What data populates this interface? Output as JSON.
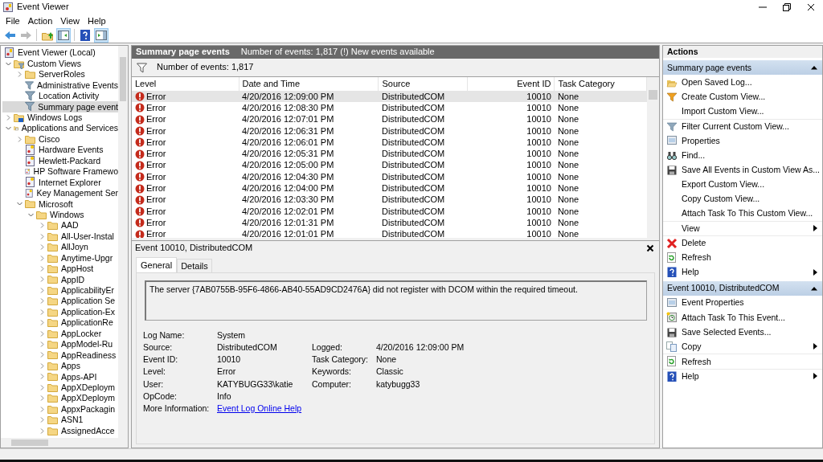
{
  "window": {
    "title": "Event Viewer"
  },
  "menu": [
    "File",
    "Action",
    "View",
    "Help"
  ],
  "toolbar": [
    {
      "kind": "back",
      "disabled": false,
      "pressed": false
    },
    {
      "kind": "forward",
      "disabled": true,
      "pressed": false
    },
    {
      "kind": "separator"
    },
    {
      "kind": "up",
      "disabled": false,
      "pressed": false
    },
    {
      "kind": "console-tree",
      "disabled": false,
      "pressed": true
    },
    {
      "kind": "separator"
    },
    {
      "kind": "help",
      "disabled": false,
      "pressed": false
    },
    {
      "kind": "action-pane",
      "disabled": false,
      "pressed": true
    }
  ],
  "tree": {
    "root": {
      "label": "Event Viewer (Local)",
      "selected": false
    },
    "children": [
      {
        "label": "Custom Views",
        "kind": "custom-views",
        "expanded": true,
        "selected": false,
        "children": [
          {
            "label": "ServerRoles",
            "kind": "folder",
            "expanded": false,
            "selected": false
          },
          {
            "label": "Administrative Events",
            "kind": "filter",
            "selected": false
          },
          {
            "label": "Location Activity",
            "kind": "filter",
            "selected": false
          },
          {
            "label": "Summary page event",
            "kind": "filter",
            "selected": true
          }
        ]
      },
      {
        "label": "Windows Logs",
        "kind": "windows-logs",
        "expanded": false,
        "selected": false
      },
      {
        "label": "Applications and Services",
        "kind": "apps",
        "expanded": true,
        "selected": false,
        "children": [
          {
            "label": "Cisco",
            "kind": "folder",
            "expanded": false,
            "selected": false
          },
          {
            "label": "Hardware Events",
            "kind": "log",
            "selected": false
          },
          {
            "label": "Hewlett-Packard",
            "kind": "log",
            "selected": false
          },
          {
            "label": "HP Software Framewo",
            "kind": "log",
            "selected": false
          },
          {
            "label": "Internet Explorer",
            "kind": "log",
            "selected": false
          },
          {
            "label": "Key Management Ser",
            "kind": "log",
            "selected": false
          },
          {
            "label": "Microsoft",
            "kind": "folder",
            "expanded": true,
            "selected": false,
            "children": [
              {
                "label": "Windows",
                "kind": "folder",
                "expanded": true,
                "selected": false,
                "children": [
                  {
                    "label": "AAD",
                    "kind": "folder",
                    "expanded": false,
                    "selected": false
                  },
                  {
                    "label": "All-User-Instal",
                    "kind": "folder",
                    "expanded": false,
                    "selected": false
                  },
                  {
                    "label": "AllJoyn",
                    "kind": "folder",
                    "expanded": false,
                    "selected": false
                  },
                  {
                    "label": "Anytime-Upgr",
                    "kind": "folder",
                    "expanded": false,
                    "selected": false
                  },
                  {
                    "label": "AppHost",
                    "kind": "folder",
                    "expanded": false,
                    "selected": false
                  },
                  {
                    "label": "AppID",
                    "kind": "folder",
                    "expanded": false,
                    "selected": false
                  },
                  {
                    "label": "ApplicabilityEr",
                    "kind": "folder",
                    "expanded": false,
                    "selected": false
                  },
                  {
                    "label": "Application Se",
                    "kind": "folder",
                    "expanded": false,
                    "selected": false
                  },
                  {
                    "label": "Application-Ex",
                    "kind": "folder",
                    "expanded": false,
                    "selected": false
                  },
                  {
                    "label": "ApplicationRe",
                    "kind": "folder",
                    "expanded": false,
                    "selected": false
                  },
                  {
                    "label": "AppLocker",
                    "kind": "folder",
                    "expanded": false,
                    "selected": false
                  },
                  {
                    "label": "AppModel-Ru",
                    "kind": "folder",
                    "expanded": false,
                    "selected": false
                  },
                  {
                    "label": "AppReadiness",
                    "kind": "folder",
                    "expanded": false,
                    "selected": false
                  },
                  {
                    "label": "Apps",
                    "kind": "folder",
                    "expanded": false,
                    "selected": false
                  },
                  {
                    "label": "Apps-API",
                    "kind": "folder",
                    "expanded": false,
                    "selected": false
                  },
                  {
                    "label": "AppXDeploym",
                    "kind": "folder",
                    "expanded": false,
                    "selected": false
                  },
                  {
                    "label": "AppXDeploym",
                    "kind": "folder",
                    "expanded": false,
                    "selected": false
                  },
                  {
                    "label": "AppxPackagin",
                    "kind": "folder",
                    "expanded": false,
                    "selected": false
                  },
                  {
                    "label": "ASN1",
                    "kind": "folder",
                    "expanded": false,
                    "selected": false
                  },
                  {
                    "label": "AssignedAcce",
                    "kind": "folder",
                    "expanded": false,
                    "selected": false
                  }
                ]
              }
            ]
          }
        ]
      }
    ]
  },
  "events_panel": {
    "title": "Summary page events",
    "status": "Number of events: 1,817 (!) New events available",
    "filter_text": "Number of events: 1,817",
    "columns": [
      "Level",
      "Date and Time",
      "Source",
      "Event ID",
      "Task Category"
    ],
    "rows": [
      {
        "kind": "error",
        "severity": "Error",
        "date": "4/20/2016 12:09:00 PM",
        "source": "DistributedCOM",
        "event_id": "10010",
        "task_category": "None",
        "selected": true
      },
      {
        "kind": "error",
        "severity": "Error",
        "date": "4/20/2016 12:08:30 PM",
        "source": "DistributedCOM",
        "event_id": "10010",
        "task_category": "None",
        "selected": false
      },
      {
        "kind": "error",
        "severity": "Error",
        "date": "4/20/2016 12:07:01 PM",
        "source": "DistributedCOM",
        "event_id": "10010",
        "task_category": "None",
        "selected": false
      },
      {
        "kind": "error",
        "severity": "Error",
        "date": "4/20/2016 12:06:31 PM",
        "source": "DistributedCOM",
        "event_id": "10010",
        "task_category": "None",
        "selected": false
      },
      {
        "kind": "error",
        "severity": "Error",
        "date": "4/20/2016 12:06:01 PM",
        "source": "DistributedCOM",
        "event_id": "10010",
        "task_category": "None",
        "selected": false
      },
      {
        "kind": "error",
        "severity": "Error",
        "date": "4/20/2016 12:05:31 PM",
        "source": "DistributedCOM",
        "event_id": "10010",
        "task_category": "None",
        "selected": false
      },
      {
        "kind": "error",
        "severity": "Error",
        "date": "4/20/2016 12:05:00 PM",
        "source": "DistributedCOM",
        "event_id": "10010",
        "task_category": "None",
        "selected": false
      },
      {
        "kind": "error",
        "severity": "Error",
        "date": "4/20/2016 12:04:30 PM",
        "source": "DistributedCOM",
        "event_id": "10010",
        "task_category": "None",
        "selected": false
      },
      {
        "kind": "error",
        "severity": "Error",
        "date": "4/20/2016 12:04:00 PM",
        "source": "DistributedCOM",
        "event_id": "10010",
        "task_category": "None",
        "selected": false
      },
      {
        "kind": "error",
        "severity": "Error",
        "date": "4/20/2016 12:03:30 PM",
        "source": "DistributedCOM",
        "event_id": "10010",
        "task_category": "None",
        "selected": false
      },
      {
        "kind": "error",
        "severity": "Error",
        "date": "4/20/2016 12:02:01 PM",
        "source": "DistributedCOM",
        "event_id": "10010",
        "task_category": "None",
        "selected": false
      },
      {
        "kind": "error",
        "severity": "Error",
        "date": "4/20/2016 12:01:31 PM",
        "source": "DistributedCOM",
        "event_id": "10010",
        "task_category": "None",
        "selected": false
      },
      {
        "kind": "error",
        "severity": "Error",
        "date": "4/20/2016 12:01:01 PM",
        "source": "DistributedCOM",
        "event_id": "10010",
        "task_category": "None",
        "selected": false
      }
    ]
  },
  "detail": {
    "title": "Event 10010, DistributedCOM",
    "tabs": [
      {
        "label": "General",
        "selected": true
      },
      {
        "label": "Details",
        "selected": false
      }
    ],
    "message": "The server {7AB0755B-95F6-4866-AB40-55AD9CD2476A} did not register with DCOM within the required timeout.",
    "fields": [
      [
        {
          "label": "Log Name:",
          "value": "System"
        }
      ],
      [
        {
          "label": "Source:",
          "value": "DistributedCOM"
        },
        {
          "label": "Logged:",
          "value": "4/20/2016 12:09:00 PM"
        }
      ],
      [
        {
          "label": "Event ID:",
          "value": "10010"
        },
        {
          "label": "Task Category:",
          "value": "None"
        }
      ],
      [
        {
          "label": "Level:",
          "value": "Error"
        },
        {
          "label": "Keywords:",
          "value": "Classic"
        }
      ],
      [
        {
          "label": "User:",
          "value": "KATYBUGG33\\katie"
        },
        {
          "label": "Computer:",
          "value": "katybugg33"
        }
      ],
      [
        {
          "label": "OpCode:",
          "value": "Info"
        }
      ],
      [
        {
          "label": "More Information:",
          "value": "Event Log Online Help",
          "kind": "link"
        }
      ]
    ]
  },
  "actions": {
    "title": "Actions",
    "sections": [
      {
        "title": "Summary page events",
        "expanded": true,
        "items": [
          {
            "label": "Open Saved Log...",
            "submenu": false,
            "separator_before": false
          },
          {
            "label": "Create Custom View...",
            "submenu": false,
            "separator_before": false
          },
          {
            "label": "Import Custom View...",
            "submenu": false,
            "separator_before": false
          },
          {
            "label": "Filter Current Custom View...",
            "submenu": false,
            "separator_before": true
          },
          {
            "label": "Properties",
            "submenu": false,
            "separator_before": false
          },
          {
            "label": "Find...",
            "submenu": false,
            "separator_before": false
          },
          {
            "label": "Save All Events in Custom View As...",
            "submenu": false,
            "separator_before": false
          },
          {
            "label": "Export Custom View...",
            "submenu": false,
            "separator_before": false
          },
          {
            "label": "Copy Custom View...",
            "submenu": false,
            "separator_before": false
          },
          {
            "label": "Attach Task To This Custom View...",
            "submenu": false,
            "separator_before": false
          },
          {
            "label": "View",
            "submenu": true,
            "separator_before": true
          },
          {
            "label": "Delete",
            "submenu": false,
            "separator_before": true
          },
          {
            "label": "Refresh",
            "submenu": false,
            "separator_before": false
          },
          {
            "label": "Help",
            "submenu": true,
            "separator_before": false
          }
        ]
      },
      {
        "title": "Event 10010, DistributedCOM",
        "expanded": true,
        "items": [
          {
            "label": "Event Properties",
            "submenu": false,
            "separator_before": false
          },
          {
            "label": "Attach Task To This Event...",
            "submenu": false,
            "separator_before": false
          },
          {
            "label": "Save Selected Events...",
            "submenu": false,
            "separator_before": false
          },
          {
            "label": "Copy",
            "submenu": true,
            "separator_before": false
          },
          {
            "label": "Refresh",
            "submenu": false,
            "separator_before": true
          },
          {
            "label": "Help",
            "submenu": true,
            "separator_before": true
          }
        ]
      }
    ]
  }
}
